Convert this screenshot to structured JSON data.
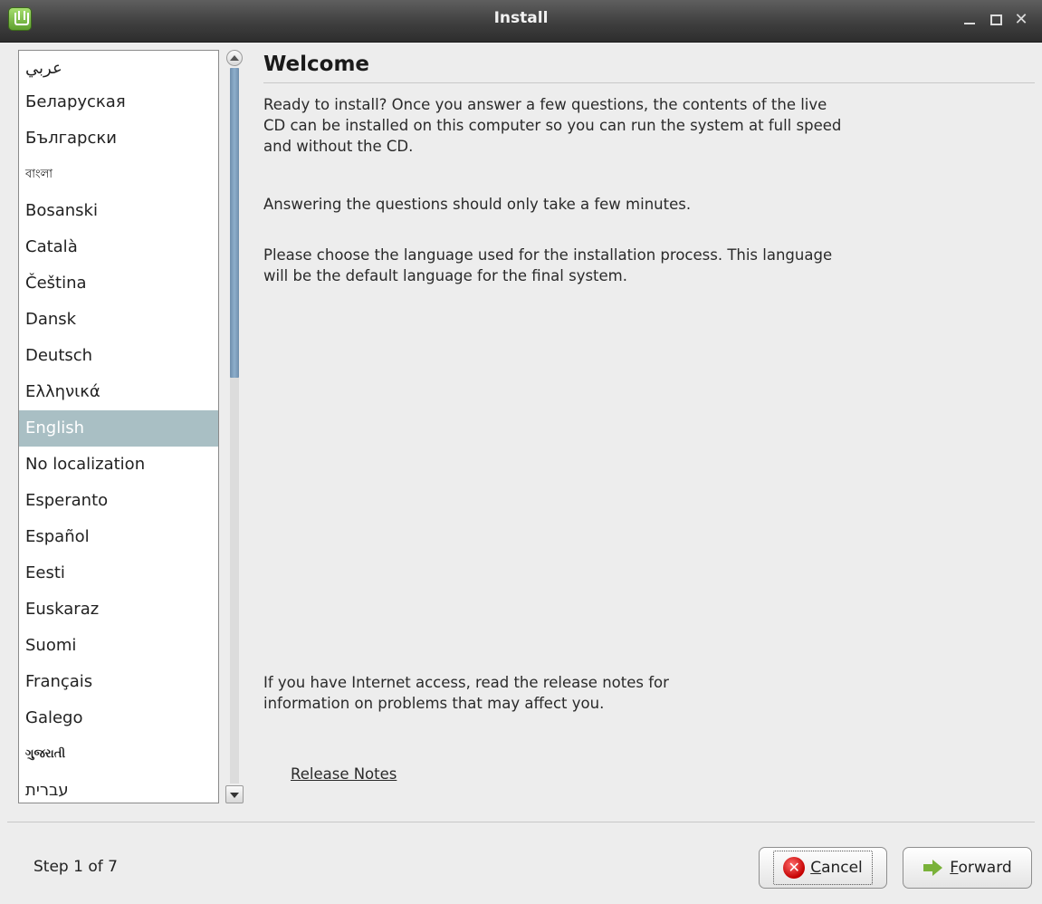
{
  "window": {
    "title": "Install"
  },
  "languages": [
    "عربي",
    "Беларуская",
    "Български",
    "বাংলা",
    "Bosanski",
    "Català",
    "Čeština",
    "Dansk",
    "Deutsch",
    "Ελληνικά",
    "English",
    "No localization",
    "Esperanto",
    "Español",
    "Eesti",
    "Euskaraz",
    "Suomi",
    "Français",
    "Galego",
    "ગુજરાતી",
    "עברית"
  ],
  "selected_language": "English",
  "main": {
    "heading": "Welcome",
    "paragraph1": "Ready to install? Once you answer a few questions, the contents of the live CD can be installed on this computer so you can run the system at full speed and without the CD.",
    "paragraph2": "Answering the questions should only take a few minutes.",
    "paragraph3": "Please choose the language used for the installation process. This language will be the default language for the final system.",
    "release_info": "If you have Internet access, read the release notes for information on problems that may affect you.",
    "release_link": "Release Notes"
  },
  "footer": {
    "step": "Step 1 of 7",
    "cancel_mnemonic": "C",
    "cancel_rest": "ancel",
    "forward_mnemonic": "F",
    "forward_rest": "orward"
  },
  "icons": {
    "app": "mint-logo-icon",
    "minimize": "minimize-icon",
    "maximize": "maximize-icon",
    "close": "close-icon",
    "cancel": "cancel-icon",
    "forward": "forward-arrow-icon"
  },
  "colors": {
    "selection": "#a9bfc4",
    "scroll_thumb": "#7f9fbd",
    "cancel_icon": "#d40000",
    "forward_icon": "#7ab23a"
  }
}
